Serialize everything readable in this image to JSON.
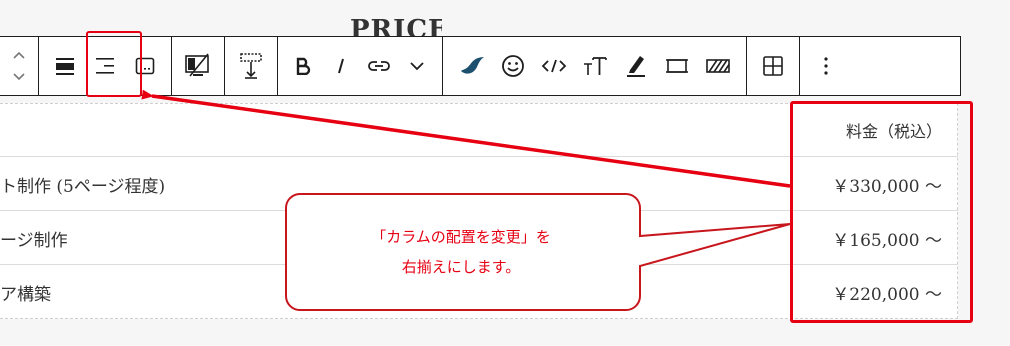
{
  "section": {
    "heading": "PRICE"
  },
  "toolbar": {
    "groups": [
      {
        "name": "move",
        "buttons": [
          {
            "icon": "move-up-down-icon",
            "label": "上下に移動"
          }
        ]
      },
      {
        "name": "align",
        "buttons": [
          {
            "icon": "align-full-icon",
            "label": "全幅"
          },
          {
            "icon": "align-right-icon",
            "label": "右揃え",
            "highlighted": true
          },
          {
            "icon": "caption-icon",
            "label": "キャプション"
          }
        ]
      },
      {
        "name": "media",
        "buttons": [
          {
            "icon": "no-image-icon",
            "label": "画像なし"
          }
        ]
      },
      {
        "name": "height",
        "buttons": [
          {
            "icon": "vertical-align-icon",
            "label": "高さ"
          }
        ]
      },
      {
        "name": "format",
        "buttons": [
          {
            "icon": "bold-icon",
            "label": "B"
          },
          {
            "icon": "italic-icon",
            "label": "I"
          },
          {
            "icon": "link-icon",
            "label": "リンク"
          },
          {
            "icon": "chevron-down-icon",
            "label": "その他"
          }
        ]
      },
      {
        "name": "extra",
        "buttons": [
          {
            "icon": "brush-icon",
            "label": "ブラシ"
          },
          {
            "icon": "smiley-icon",
            "label": "絵文字"
          },
          {
            "icon": "code-icon",
            "label": "コード"
          },
          {
            "icon": "font-size-icon",
            "label": "文字サイズ"
          },
          {
            "icon": "highlighter-icon",
            "label": "マーカー"
          },
          {
            "icon": "frame-icon",
            "label": "枠"
          },
          {
            "icon": "striped-box-icon",
            "label": "背景"
          }
        ]
      },
      {
        "name": "table",
        "buttons": [
          {
            "icon": "table-icon",
            "label": "表"
          }
        ]
      },
      {
        "name": "more",
        "buttons": [
          {
            "icon": "more-vertical-icon",
            "label": "オプション"
          }
        ]
      }
    ]
  },
  "table": {
    "header": {
      "price": "料金（税込）"
    },
    "rows": [
      {
        "service": "ト制作 (5ページ程度)",
        "price": "￥330,000 〜"
      },
      {
        "service": "ージ制作",
        "price": "￥165,000 〜"
      },
      {
        "service": "ア構築",
        "price": "￥220,000 〜"
      }
    ]
  },
  "annotation": {
    "line1": "「カラムの配置を変更」を",
    "line2": "右揃えにします。",
    "color": "#e60012"
  }
}
